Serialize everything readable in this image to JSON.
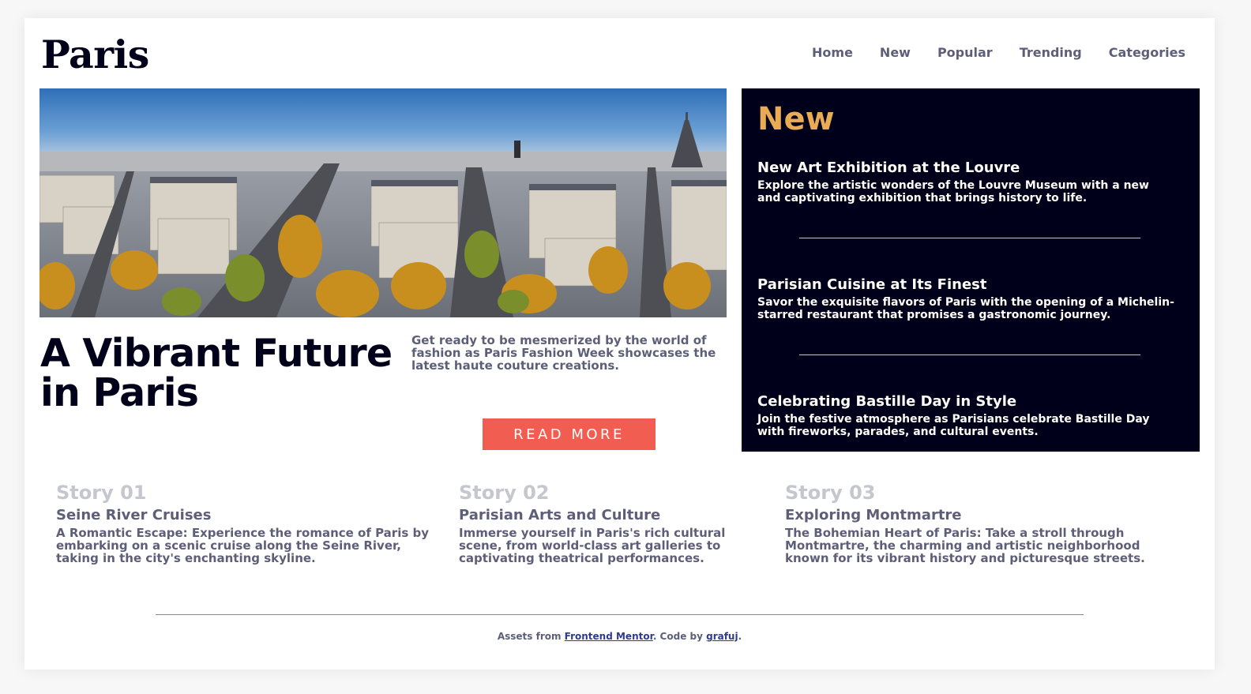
{
  "header": {
    "logo": "Paris",
    "nav": [
      "Home",
      "New",
      "Popular",
      "Trending",
      "Categories"
    ]
  },
  "hero": {
    "image_alt": "Paris city panorama",
    "title": "A Vibrant Future in Paris",
    "description": "Get ready to be mesmerized by the world of fashion as Paris Fashion Week showcases the latest haute couture creations.",
    "button_label": "READ MORE"
  },
  "new_panel": {
    "title": "New",
    "items": [
      {
        "title": "New Art Exhibition at the Louvre",
        "text": "Explore the artistic wonders of the Louvre Museum with a new and captivating exhibition that brings history to life."
      },
      {
        "title": "Parisian Cuisine at Its Finest",
        "text": "Savor the exquisite flavors of Paris with the opening of a Michelin-starred restaurant that promises a gastronomic journey."
      },
      {
        "title": "Celebrating Bastille Day in Style",
        "text": "Join the festive atmosphere as Parisians celebrate Bastille Day with fireworks, parades, and cultural events."
      }
    ]
  },
  "stories": [
    {
      "number": "Story 01",
      "title": "Seine River Cruises",
      "text": "A Romantic Escape: Experience the romance of Paris by embarking on a scenic cruise along the Seine River, taking in the city's enchanting skyline."
    },
    {
      "number": "Story 02",
      "title": "Parisian Arts and Culture",
      "text": "Immerse yourself in Paris's rich cultural scene, from world-class art galleries to captivating theatrical performances."
    },
    {
      "number": "Story 03",
      "title": "Exploring Montmartre",
      "text": "The Bohemian Heart of Paris: Take a stroll through Montmartre, the charming and artistic neighborhood known for its vibrant history and picturesque streets."
    }
  ],
  "footer": {
    "prefix": "Assets from ",
    "link1": "Frontend Mentor",
    "middle": ". Code by ",
    "link2": "grafuj",
    "suffix": "."
  },
  "colors": {
    "dark_navy": "#00001a",
    "accent_orange": "#e9ab53",
    "button_red": "#f15d51",
    "gray_text": "#5d5f79",
    "light_gray": "#c5c6ce"
  }
}
